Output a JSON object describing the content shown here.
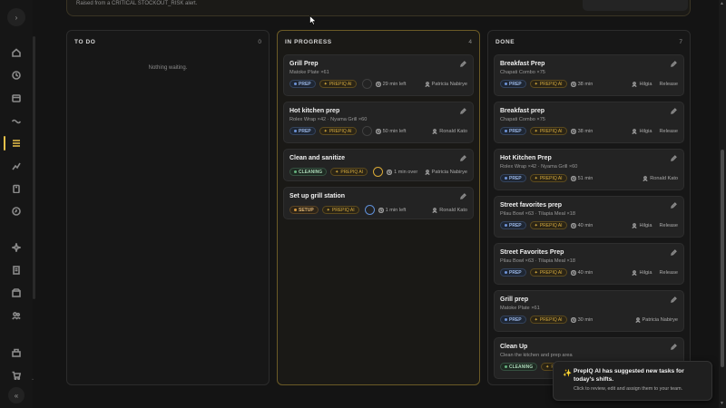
{
  "banner": {
    "alert_text": "Raised from a CRITICAL STOCKOUT_RISK alert."
  },
  "rail": {
    "expand_label": "›",
    "collapse_label": "«",
    "icons": [
      "home-icon",
      "clock-icon",
      "calendar-icon",
      "ocean-icon",
      "tasks-icon",
      "chart-icon",
      "clipboard-icon",
      "history-icon",
      "sparkles-icon",
      "receipt-icon",
      "inventory-icon",
      "team-icon",
      "register-icon",
      "cart-icon"
    ]
  },
  "columns": {
    "todo": {
      "title": "TO DO",
      "count": "0",
      "empty_text": "Nothing waiting."
    },
    "progress": {
      "title": "IN PROGRESS",
      "count": "4",
      "cards": [
        {
          "title": "Grill Prep",
          "subtitle": "Matoke Plate ×61",
          "tag": "PREP",
          "ai": "PREPIQ AI",
          "time": "29 min left",
          "assignee": "Patricia Nabirye"
        },
        {
          "title": "Hot kitchen prep",
          "subtitle": "Rolex Wrap ×42 · Nyama Grill ×60",
          "tag": "PREP",
          "ai": "PREPIQ AI",
          "time": "50 min left",
          "assignee": "Ronald Kato"
        },
        {
          "title": "Clean and sanitize",
          "tag": "CLEANING",
          "ai": "PREPIQ AI",
          "time": "1 min over",
          "assignee": "Patricia Nabirye"
        },
        {
          "title": "Set up grill station",
          "tag": "SETUP",
          "ai": "PREPIQ AI",
          "time": "1 min left",
          "assignee": "Ronald Kato"
        }
      ]
    },
    "done": {
      "title": "DONE",
      "count": "7",
      "cards": [
        {
          "title": "Breakfast Prep",
          "subtitle": "Chapati Combo ×75",
          "tag": "PREP",
          "ai": "PREPIQ AI",
          "time": "38 min",
          "assignee": "Hilgia",
          "release": "Release"
        },
        {
          "title": "Breakfast prep",
          "subtitle": "Chapati Combo ×75",
          "tag": "PREP",
          "ai": "PREPIQ AI",
          "time": "38 min",
          "assignee": "Hilgia",
          "release": "Release"
        },
        {
          "title": "Hot Kitchen Prep",
          "subtitle": "Rolex Wrap ×42 · Nyama Grill ×60",
          "tag": "PREP",
          "ai": "PREPIQ AI",
          "time": "51 min",
          "assignee": "Ronald Kato"
        },
        {
          "title": "Street favorites prep",
          "subtitle": "Pilau Bowl ×63 · Tilapia Meal ×18",
          "tag": "PREP",
          "ai": "PREPIQ AI",
          "time": "40 min",
          "assignee": "Hilgia",
          "release": "Release"
        },
        {
          "title": "Street Favorites Prep",
          "subtitle": "Pilau Bowl ×63 · Tilapia Meal ×18",
          "tag": "PREP",
          "ai": "PREPIQ AI",
          "time": "40 min",
          "assignee": "Hilgia",
          "release": "Release"
        },
        {
          "title": "Grill prep",
          "subtitle": "Matoke Plate ×61",
          "tag": "PREP",
          "ai": "PREPIQ AI",
          "time": "30 min",
          "assignee": "Patricia Nabirye"
        },
        {
          "title": "Clean Up",
          "subtitle": "Clean the kitchen and prep area",
          "tag": "CLEANING",
          "ai": "P"
        }
      ]
    }
  },
  "toast": {
    "title": "PrepIQ AI has suggested new tasks for today's shifts.",
    "body": "Click to review, edit and assign them to your team."
  },
  "colors": {
    "accent": "#e8c14a",
    "background": "#141414",
    "card": "#232323",
    "prep_tag": "#6e94d8",
    "cleaning_tag": "#66b37f",
    "setup_tag": "#d89a40"
  }
}
